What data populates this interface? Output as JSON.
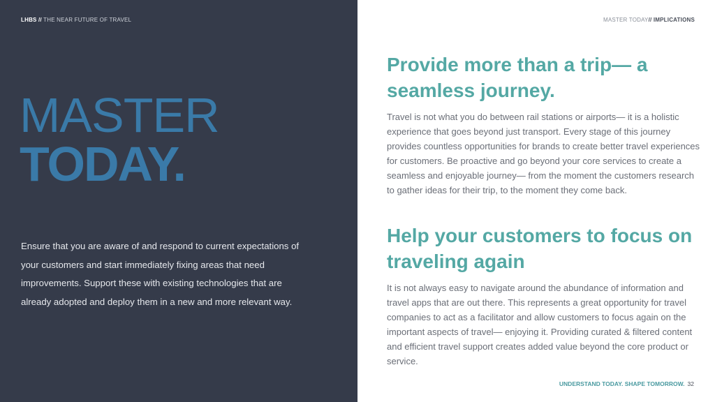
{
  "header_left": {
    "brand": "LHBS //",
    "subtitle": " THE NEAR FUTURE OF TRAVEL"
  },
  "header_right": {
    "section": "MASTER TODAY",
    "subsection": "// IMPLICATIONS"
  },
  "hero": {
    "line1": "MASTER",
    "line2": "TODAY."
  },
  "left_body": "Ensure that you are aware of and respond to current expectations of your customers and start immediately fixing areas that need improvements. Support these with existing technologies that are already adopted and deploy them in a new and more relevant way.",
  "sections": [
    {
      "heading": "Provide more than a trip— a seamless journey.",
      "body": "Travel is not what you do between rail stations or airports— it is a holistic experience that goes beyond just transport. Every stage of this journey provides countless opportunities for brands to create better travel experiences for customers. Be proactive and go beyond your core services to create a seamless and enjoyable journey— from the moment the customers research to gather ideas for their trip, to the moment they come back."
    },
    {
      "heading": "Help your customers to focus on traveling again",
      "body": "It is not always easy to navigate around the abundance of information and travel apps that are out there. This represents a great opportunity for travel companies to act as a facilitator and allow customers to focus again on the important aspects of travel— enjoying it.  Providing curated & filtered content and efficient travel support creates added value beyond the core product or service."
    }
  ],
  "footer": {
    "tagline": "UNDERSTAND TODAY. SHAPE TOMORROW.",
    "page_number": "32"
  },
  "colors": {
    "dark_panel": "#353b4a",
    "hero_blue": "#3a7aa8",
    "heading_teal": "#54a8a4"
  }
}
